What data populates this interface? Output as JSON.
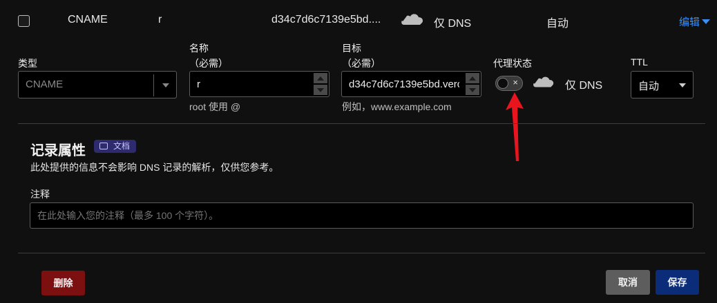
{
  "record_row": {
    "type": "CNAME",
    "name": "r",
    "target": "d34c7d6c7139e5bd....",
    "proxy_status": "仅 DNS",
    "ttl": "自动",
    "edit_label": "编辑"
  },
  "form": {
    "type_label": "类型",
    "type_value": "CNAME",
    "name_label_line1": "名称",
    "name_label_line2": "（必需）",
    "name_value": "r",
    "name_help": "root 使用 @",
    "target_label_line1": "目标",
    "target_label_line2": "（必需）",
    "target_value": "d34c7d6c7139e5bd.verc",
    "target_help": "例如，www.example.com",
    "proxy_label": "代理状态",
    "proxy_toggle_on": false,
    "proxy_toggle_glyph": "×",
    "proxy_status": "仅 DNS",
    "ttl_label": "TTL",
    "ttl_value": "自动"
  },
  "record_attributes": {
    "title": "记录属性",
    "doc_badge": "文档",
    "description": "此处提供的信息不会影响 DNS 记录的解析，仅供您参考。",
    "note_label": "注释",
    "note_placeholder": "在此处输入您的注释（最多 100 个字符）。"
  },
  "actions": {
    "delete": "删除",
    "cancel": "取消",
    "save": "保存"
  },
  "colors": {
    "link": "#3b8ff6",
    "delete": "#7c1010",
    "save": "#0a2c79",
    "cancel": "#5d5d5d",
    "badge": "#2e2a6e",
    "annotation_arrow": "#e8141e"
  }
}
